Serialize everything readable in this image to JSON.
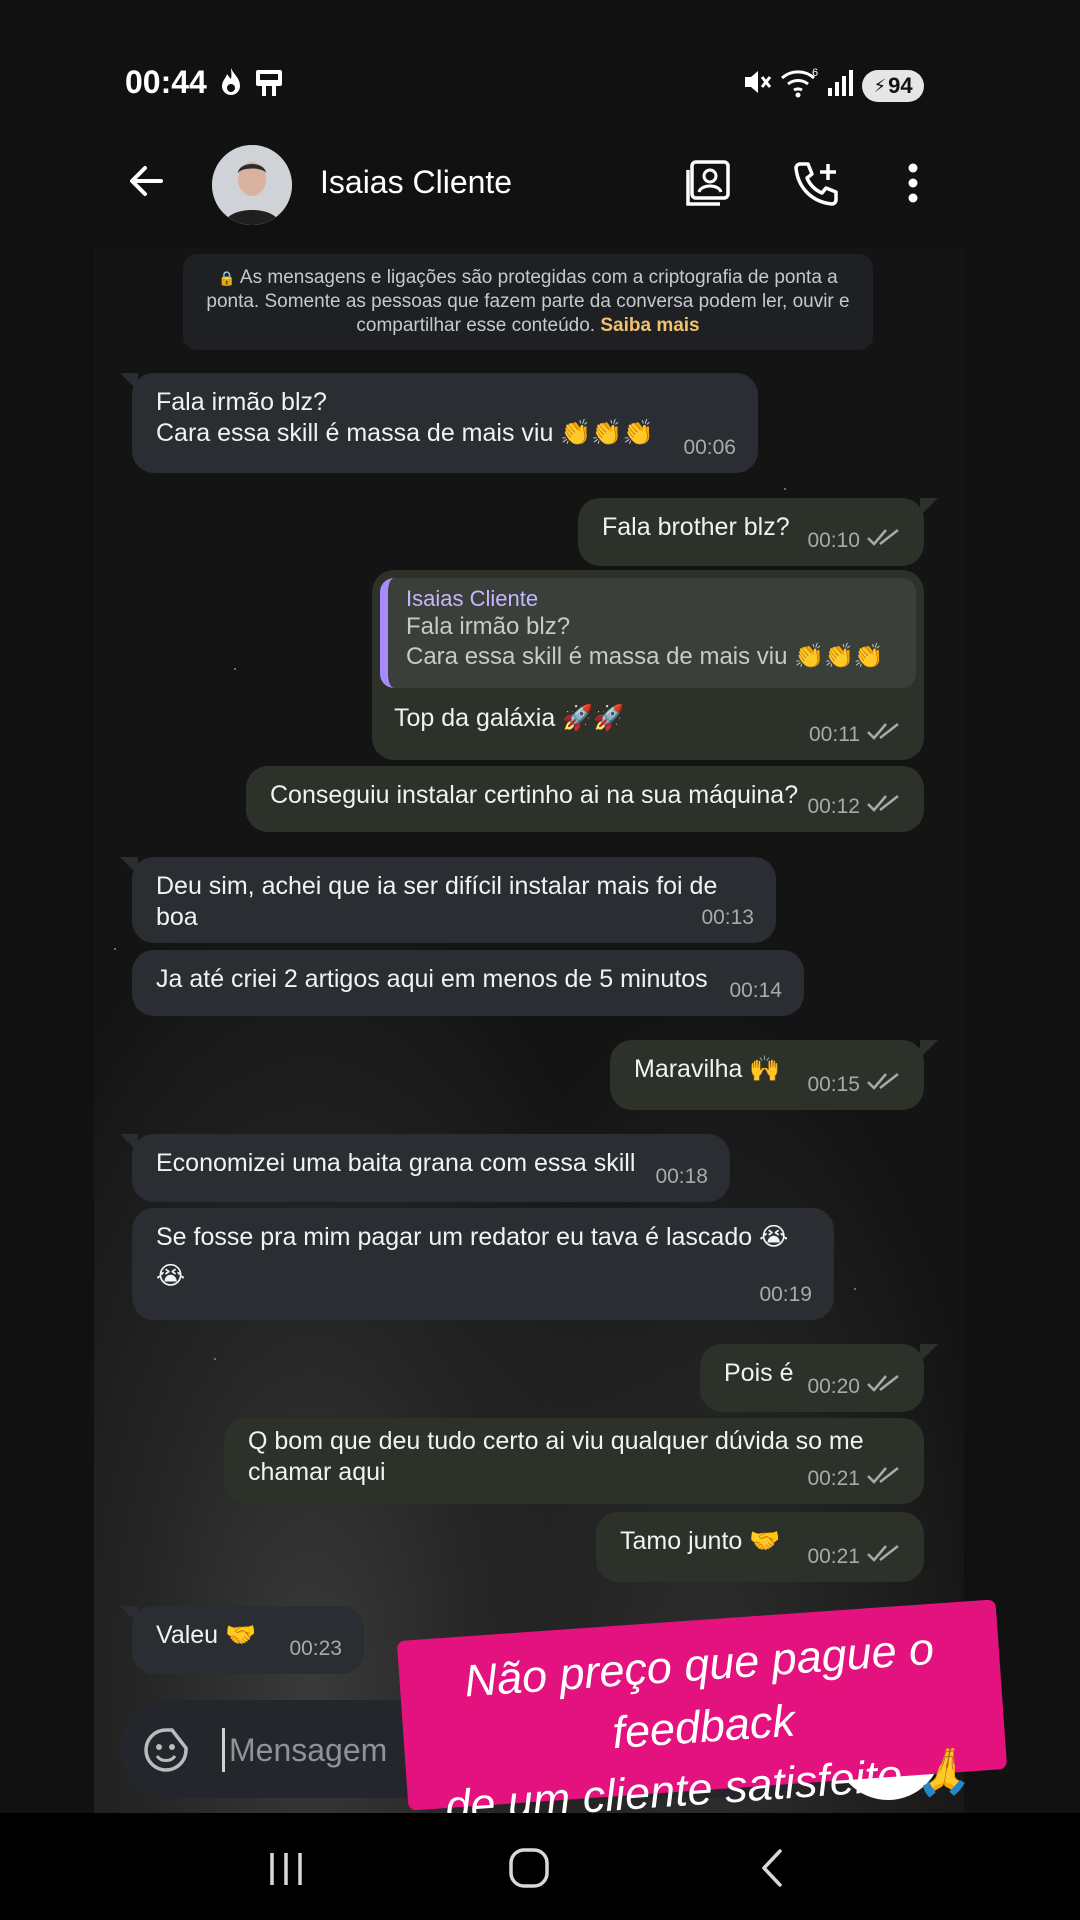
{
  "status_bar": {
    "time": "00:44",
    "battery": "94",
    "wifi_badge": "6"
  },
  "header": {
    "contact_name": "Isaias Cliente"
  },
  "encryption_notice": {
    "text": "As mensagens e ligações são protegidas com a criptografia de ponta a ponta. Somente as pessoas que fazem parte da conversa podem ler, ouvir e compartilhar esse conteúdo.",
    "link": "Saiba mais"
  },
  "messages": [
    {
      "direction": "in",
      "line1": "Fala irmão blz?",
      "line2": "Cara essa skill é massa de mais viu 👏👏👏",
      "time": "00:06"
    },
    {
      "direction": "out",
      "text": "Fala brother blz?",
      "time": "00:10"
    },
    {
      "direction": "out",
      "quote_name": "Isaias Cliente",
      "quote_line1": "Fala irmão blz?",
      "quote_line2": "Cara essa skill é massa de mais viu 👏👏👏",
      "text": "Top da galáxia 🚀🚀",
      "time": "00:11"
    },
    {
      "direction": "out",
      "text": "Conseguiu instalar certinho ai na sua máquina?",
      "time": "00:12"
    },
    {
      "direction": "in",
      "text": "Deu sim, achei que ia ser difícil instalar mais foi de boa",
      "time": "00:13"
    },
    {
      "direction": "in",
      "text": "Ja até criei 2 artigos aqui em menos de 5 minutos",
      "time": "00:14"
    },
    {
      "direction": "out",
      "text": "Maravilha 🙌",
      "time": "00:15"
    },
    {
      "direction": "in",
      "text": "Economizei uma baita grana com essa skill",
      "time": "00:18"
    },
    {
      "direction": "in",
      "line1": "Se fosse pra mim pagar um redator eu tava é lascado 😭",
      "line2": "😭",
      "time": "00:19"
    },
    {
      "direction": "out",
      "text": "Pois é",
      "time": "00:20"
    },
    {
      "direction": "out",
      "line1": "Q bom que deu tudo certo ai viu qualquer dúvida so me",
      "line2": "chamar aqui",
      "time": "00:21"
    },
    {
      "direction": "out",
      "text": "Tamo junto 🤝",
      "time": "00:21"
    },
    {
      "direction": "in",
      "text": "Valeu 🤝",
      "time": "00:23"
    }
  ],
  "input": {
    "placeholder": "Mensagem"
  },
  "overlay": {
    "line1": "Não preço que pague o feedback",
    "line2": "de um cliente satisfeito 🙏🙏"
  },
  "colors": {
    "accent_link": "#f3c06b",
    "quote_bar": "#a78bfa",
    "overlay_bg": "#e4127e"
  }
}
